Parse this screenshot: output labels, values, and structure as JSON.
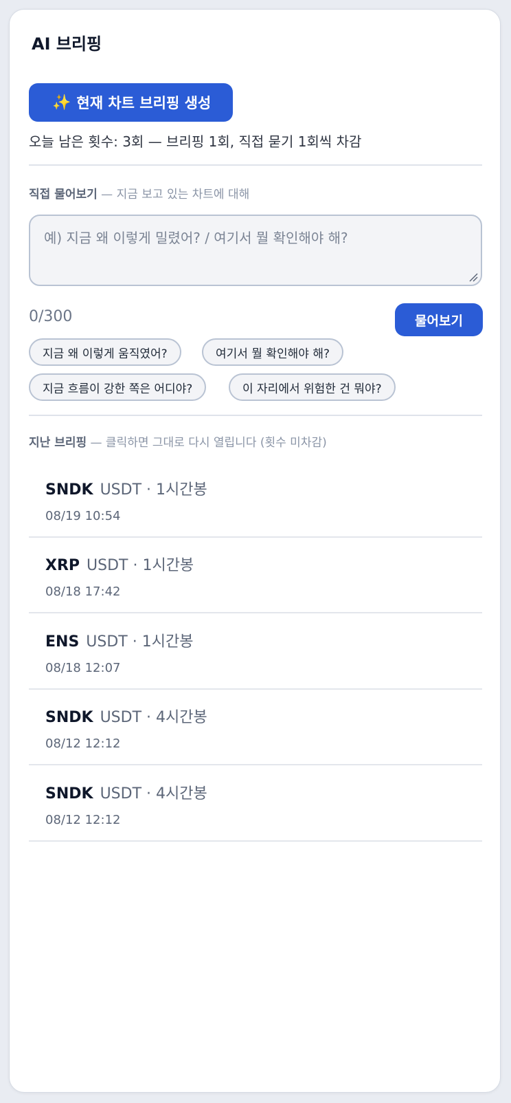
{
  "panel": {
    "title": "AI 브리핑"
  },
  "generate": {
    "icon": "sparkles-icon",
    "sparkle_glyph": "✨",
    "label": "현재 차트 브리핑 생성"
  },
  "remaining_text": "오늘 남은 횟수: 3회 — 브리핑 1회, 직접 묻기 1회씩 차감",
  "ask": {
    "label_strong": "직접 물어보기",
    "label_rest": " — 지금 보고 있는 차트에 대해",
    "placeholder": "예) 지금 왜 이렇게 밀렸어? / 여기서 뭘 확인해야 해?",
    "value": "",
    "counter": "0/300",
    "button_label": "물어보기"
  },
  "suggestions": [
    "지금 왜 이렇게 움직였어?",
    "여기서 뭘 확인해야 해?",
    "지금 흐름이 강한 쪽은 어디야?",
    "이 자리에서 위험한 건 뭐야?"
  ],
  "history": {
    "label_strong": "지난 브리핑",
    "label_rest": " — 클릭하면 그대로 다시 열립니다 (횟수 미차감)",
    "items": [
      {
        "symbol": "SNDK",
        "pair": "USDT · 1시간봉",
        "time": "08/19 10:54"
      },
      {
        "symbol": "XRP",
        "pair": "USDT · 1시간봉",
        "time": "08/18 17:42"
      },
      {
        "symbol": "ENS",
        "pair": "USDT · 1시간봉",
        "time": "08/18 12:07"
      },
      {
        "symbol": "SNDK",
        "pair": "USDT · 4시간봉",
        "time": "08/12 12:12"
      },
      {
        "symbol": "SNDK",
        "pair": "USDT · 4시간봉",
        "time": "08/12 12:12"
      }
    ]
  },
  "colors": {
    "accent": "#2b5cd6",
    "page_background": "#e9ecf2",
    "panel_background": "#ffffff"
  }
}
